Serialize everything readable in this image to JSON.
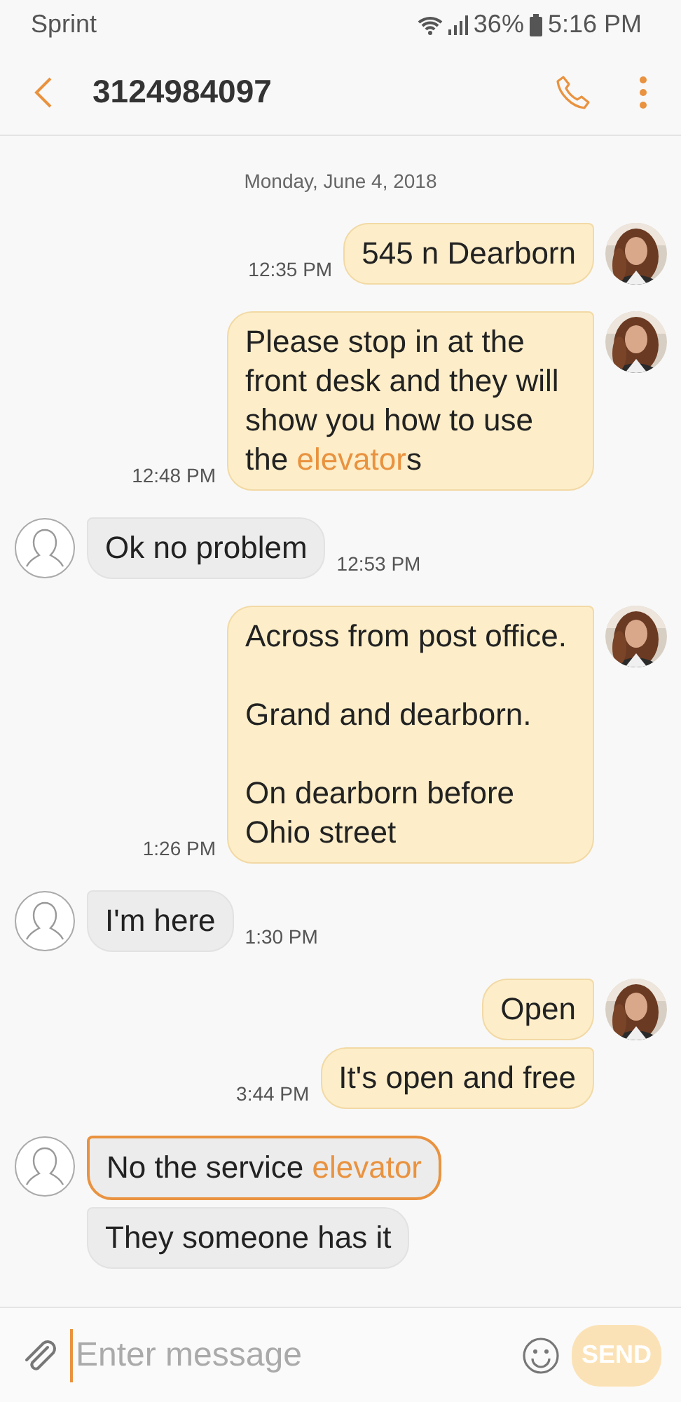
{
  "status_bar": {
    "carrier": "Sprint",
    "battery": "36%",
    "time": "5:16 PM"
  },
  "header": {
    "title": "3124984097"
  },
  "date_divider": "Monday, June 4, 2018",
  "messages": [
    {
      "kind": "sent",
      "show_avatar": true,
      "selected": false,
      "time": "12:35 PM",
      "parts": [
        {
          "text": "545 n Dearborn",
          "link": false
        }
      ]
    },
    {
      "kind": "sent",
      "show_avatar": true,
      "selected": false,
      "time": "12:48 PM",
      "parts": [
        {
          "text": "Please stop in at the front desk and they will show you how to use the ",
          "link": false
        },
        {
          "text": "elevator",
          "link": true
        },
        {
          "text": "s",
          "link": false
        }
      ]
    },
    {
      "kind": "received",
      "show_avatar": true,
      "selected": false,
      "time": "12:53 PM",
      "parts": [
        {
          "text": "Ok no problem",
          "link": false
        }
      ]
    },
    {
      "kind": "sent",
      "show_avatar": true,
      "selected": false,
      "time": "1:26 PM",
      "parts": [
        {
          "text": "Across from post office.\n\nGrand and dearborn.\n\nOn dearborn before Ohio street",
          "link": false
        }
      ]
    },
    {
      "kind": "received",
      "show_avatar": true,
      "selected": false,
      "time": "1:30 PM",
      "parts": [
        {
          "text": "I'm here",
          "link": false
        }
      ]
    },
    {
      "kind": "sent",
      "show_avatar": true,
      "selected": false,
      "parts": [
        {
          "text": "Open",
          "link": false
        }
      ]
    },
    {
      "kind": "sent",
      "show_avatar": false,
      "selected": false,
      "time": "3:44 PM",
      "parts": [
        {
          "text": "It's open and free",
          "link": false
        }
      ]
    },
    {
      "kind": "received",
      "show_avatar": true,
      "selected": true,
      "parts": [
        {
          "text": "No the service ",
          "link": false
        },
        {
          "text": "elevator",
          "link": true
        }
      ]
    },
    {
      "kind": "received",
      "show_avatar": false,
      "selected": false,
      "parts": [
        {
          "text": "They someone has it",
          "link": false
        }
      ]
    }
  ],
  "composer": {
    "placeholder": "Enter message",
    "send_label": "SEND"
  }
}
